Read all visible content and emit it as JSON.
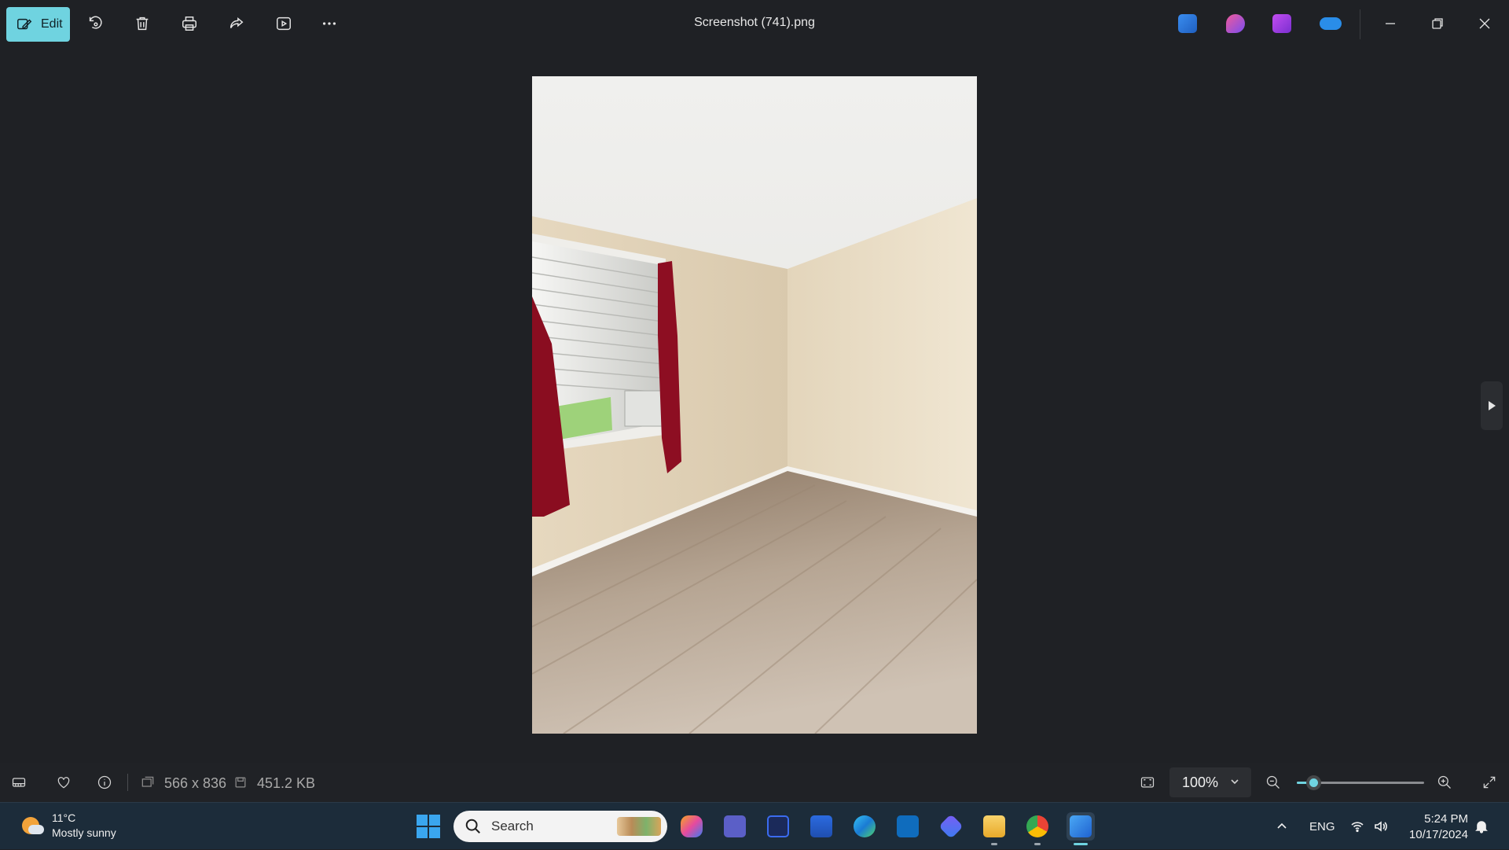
{
  "titlebar": {
    "edit_label": "Edit",
    "title": "Screenshot (741).png",
    "tools": [
      "rotate-icon",
      "delete-icon",
      "print-icon",
      "share-icon",
      "slideshow-icon",
      "more-icon"
    ],
    "app_icons": [
      "photos-app-icon",
      "designer-app-icon",
      "clipchamp-app-icon",
      "onedrive-icon"
    ],
    "window_controls": [
      "minimize-icon",
      "restore-icon",
      "close-icon"
    ]
  },
  "image_info": {
    "dimensions": "566 x 836",
    "file_size": "451.2 KB"
  },
  "zoom": {
    "level_label": "100%",
    "slider_fraction": 0.13
  },
  "taskbar": {
    "weather": {
      "temp": "11°C",
      "condition": "Mostly sunny"
    },
    "search_placeholder": "Search",
    "apps": [
      "copilot-icon",
      "teams-icon",
      "visual-studio-icon",
      "store-icon",
      "edge-icon",
      "outlook-icon",
      "copilot-pro-icon",
      "file-explorer-icon",
      "chrome-icon",
      "photos-icon"
    ],
    "language": "ENG",
    "time": "5:24 PM",
    "date": "10/17/2024"
  },
  "colors": {
    "accent": "#6fd3e0",
    "background": "#1f2125",
    "taskbar": "#1c2c3a"
  }
}
